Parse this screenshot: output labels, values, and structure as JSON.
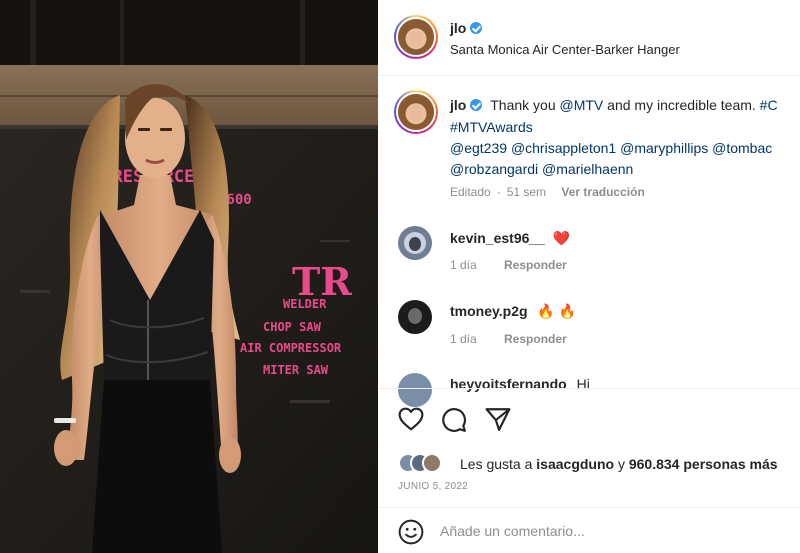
{
  "post": {
    "photo_sign": {
      "line1": "T        RESOURCES",
      "line2": "4600",
      "logo": "TR",
      "items": [
        "WELDER",
        "CHOP SAW",
        "AIR COMPRESSOR",
        "MITER SAW"
      ]
    },
    "author": {
      "username": "jlo",
      "location": "Santa Monica Air Center-Barker Hanger",
      "avatar_icon": "profile-avatar"
    },
    "caption": {
      "username": "jlo",
      "line1_prefix": "Thank you ",
      "mention_mtv": "@MTV",
      "line1_suffix": " and my incredible team. ",
      "line1_tail": "#C",
      "line2": "#MTVAwards",
      "line3_mentions": [
        "@egt239",
        "@chrisappleton1",
        "@maryphillips",
        "@tombac"
      ],
      "line4_mentions": [
        "@robzangardi",
        "@marielhaenn"
      ],
      "edited": "Editado",
      "age": "51 sem",
      "translate": "Ver traducción"
    },
    "comments": [
      {
        "username": "kevin_est96__",
        "emoji": "❤️",
        "age": "1 día",
        "reply": "Responder",
        "avatar_color": "#6f7e93"
      },
      {
        "username": "tmoney.p2g",
        "emoji": "🔥 🔥",
        "age": "1 día",
        "reply": "Responder",
        "avatar_color": "#1b1b1b"
      },
      {
        "username": "heyyoitsfernando",
        "emoji": "Hi",
        "age": "",
        "reply": "",
        "avatar_color": "#7a8ea8"
      }
    ],
    "actions": {
      "like_icon": "heart-outline-icon",
      "comment_icon": "comment-bubble-icon",
      "share_icon": "paper-plane-icon"
    },
    "likes": {
      "prefix": "Les gusta a ",
      "user": "isaacgduno",
      "middle": " y ",
      "count": "960.834 personas más"
    },
    "date": "JUNIO 5, 2022",
    "add_comment": {
      "placeholder": "Añade un comentario...",
      "emoji_icon": "smiley-icon"
    },
    "colors": {
      "verified": "#3897f0",
      "link": "#00376b",
      "heart": "#ed4956",
      "fire": "#ff8a00",
      "sign_pink": "#e84a8a"
    }
  }
}
